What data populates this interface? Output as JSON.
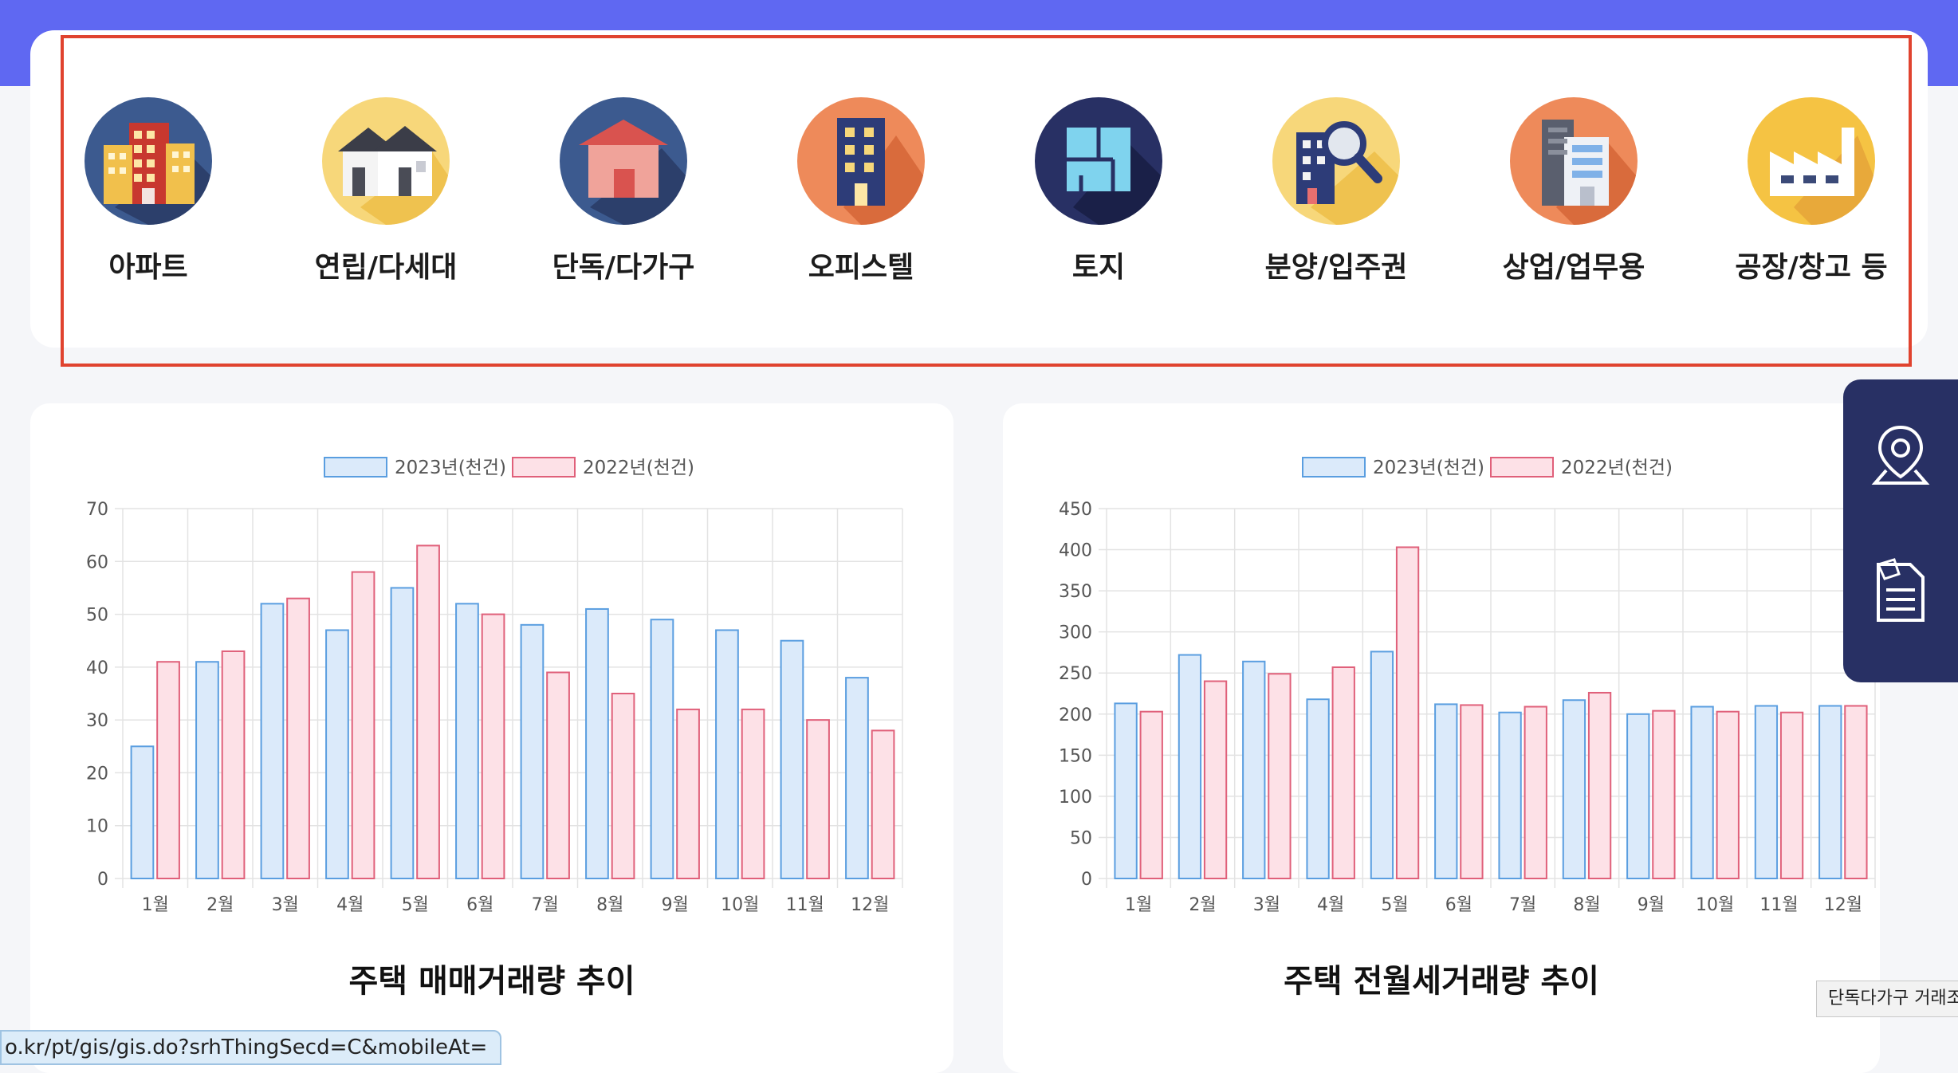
{
  "categories": [
    {
      "label": "아파트",
      "icon": "apartment-icon"
    },
    {
      "label": "연립/다세대",
      "icon": "row-house-icon"
    },
    {
      "label": "단독/다가구",
      "icon": "detached-house-icon"
    },
    {
      "label": "오피스텔",
      "icon": "officetel-icon"
    },
    {
      "label": "토지",
      "icon": "land-icon"
    },
    {
      "label": "분양/입주권",
      "icon": "presale-search-icon"
    },
    {
      "label": "상업/업무용",
      "icon": "commercial-building-icon"
    },
    {
      "label": "공장/창고 등",
      "icon": "factory-icon"
    }
  ],
  "side_panel": {
    "items": [
      {
        "icon": "map-pin-icon"
      },
      {
        "icon": "document-pen-icon"
      }
    ]
  },
  "status_url": "o.kr/pt/gis/gis.do?srhThingSecd=C&mobileAt=",
  "tooltip": "단독다가구 거래조회",
  "chart_data": [
    {
      "type": "bar",
      "title": "주택 매매거래량 추이",
      "categories": [
        "1월",
        "2월",
        "3월",
        "4월",
        "5월",
        "6월",
        "7월",
        "8월",
        "9월",
        "10월",
        "11월",
        "12월"
      ],
      "series": [
        {
          "name": "2023년(천건)",
          "values": [
            25,
            41,
            52,
            47,
            55,
            52,
            48,
            51,
            49,
            47,
            45,
            38
          ]
        },
        {
          "name": "2022년(천건)",
          "values": [
            41,
            43,
            53,
            58,
            63,
            50,
            39,
            35,
            32,
            32,
            30,
            28
          ]
        }
      ],
      "ylim": [
        0,
        70
      ],
      "yticks": [
        0,
        10,
        20,
        30,
        40,
        50,
        60,
        70
      ],
      "grid": true,
      "legend": "top-center"
    },
    {
      "type": "bar",
      "title": "주택 전월세거래량 추이",
      "categories": [
        "1월",
        "2월",
        "3월",
        "4월",
        "5월",
        "6월",
        "7월",
        "8월",
        "9월",
        "10월",
        "11월",
        "12월"
      ],
      "series": [
        {
          "name": "2023년(천건)",
          "values": [
            213,
            272,
            264,
            218,
            276,
            212,
            202,
            217,
            200,
            209,
            210,
            210
          ]
        },
        {
          "name": "2022년(천건)",
          "values": [
            203,
            240,
            249,
            257,
            403,
            211,
            209,
            226,
            204,
            203,
            202,
            210
          ]
        }
      ],
      "ylim": [
        0,
        450
      ],
      "yticks": [
        0,
        50,
        100,
        150,
        200,
        250,
        300,
        350,
        400,
        450
      ],
      "grid": true,
      "legend": "top-center"
    }
  ],
  "colors": {
    "accent": "#5f68f2",
    "highlight": "#e0432f",
    "side_panel": "#283064",
    "series_2023_fill": "#dbeafa",
    "series_2023_stroke": "#5a9ee0",
    "series_2022_fill": "#fde1e7",
    "series_2022_stroke": "#e0607a"
  }
}
